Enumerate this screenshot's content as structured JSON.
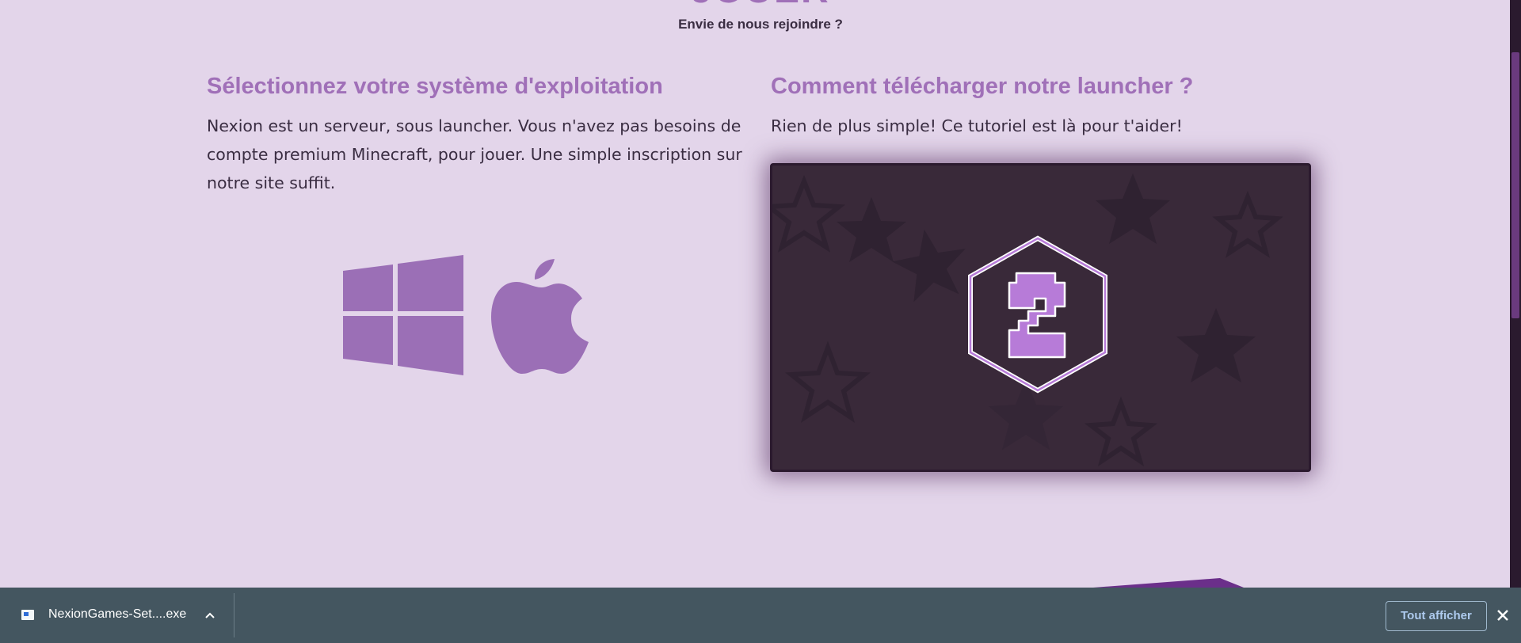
{
  "hero": {
    "title": "JOUER",
    "subtitle": "Envie de nous rejoindre ?"
  },
  "os_section": {
    "title": "Sélectionnez votre système d'exploitation",
    "text": "Nexion est un serveur, sous launcher. Vous n'avez pas besoins de compte premium Minecraft, pour jouer. Une simple inscription sur notre site suffit.",
    "buttons": [
      {
        "name": "windows",
        "icon": "windows-icon"
      },
      {
        "name": "mac",
        "icon": "apple-icon"
      }
    ]
  },
  "tutorial_section": {
    "title": "Comment télécharger notre launcher ?",
    "text": "Rien de plus simple! Ce tutoriel est là pour t'aider!",
    "video_icon": "z-hexagon-logo"
  },
  "download_bar": {
    "file_name": "NexionGames-Set....exe",
    "show_all_label": "Tout afficher",
    "close_icon": "close-icon",
    "chevron_icon": "chevron-up-icon"
  },
  "colors": {
    "background": "#e3d5ea",
    "accent": "#a070b8",
    "text": "#3a2d42",
    "video_bg": "#392939",
    "download_bar_bg": "#445660",
    "show_all_text": "#aecbef"
  }
}
